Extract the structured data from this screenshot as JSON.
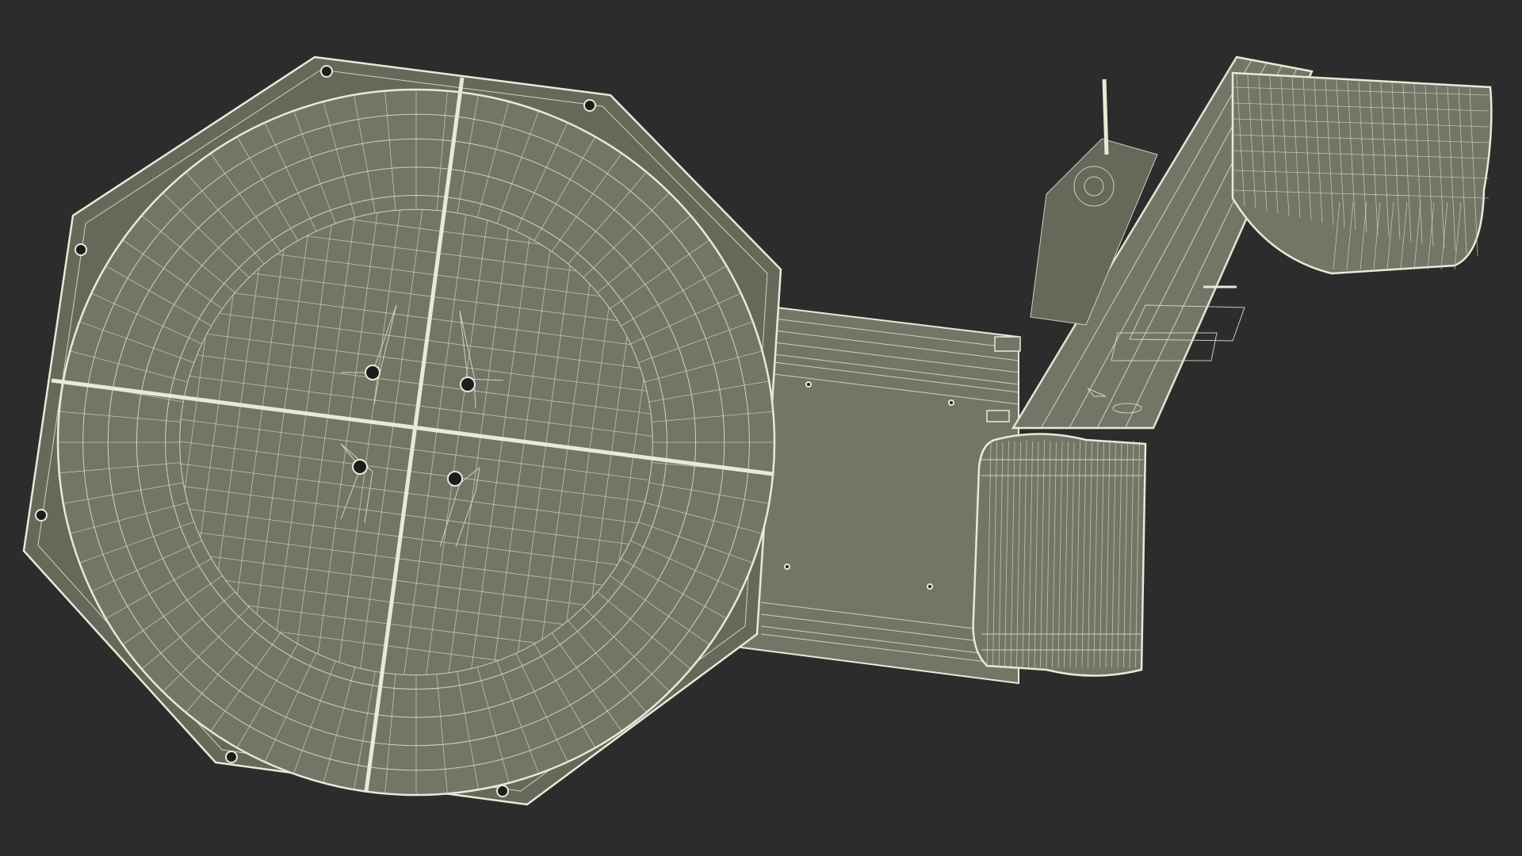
{
  "scene": {
    "subject": "wireframe-render",
    "colors": {
      "background": "#2c2c2c",
      "surface": "#747567",
      "surface_dark": "#676859",
      "wire": "#dcdccb",
      "edge": "#e9e9d8",
      "bolt": "#1d1d1d"
    }
  }
}
